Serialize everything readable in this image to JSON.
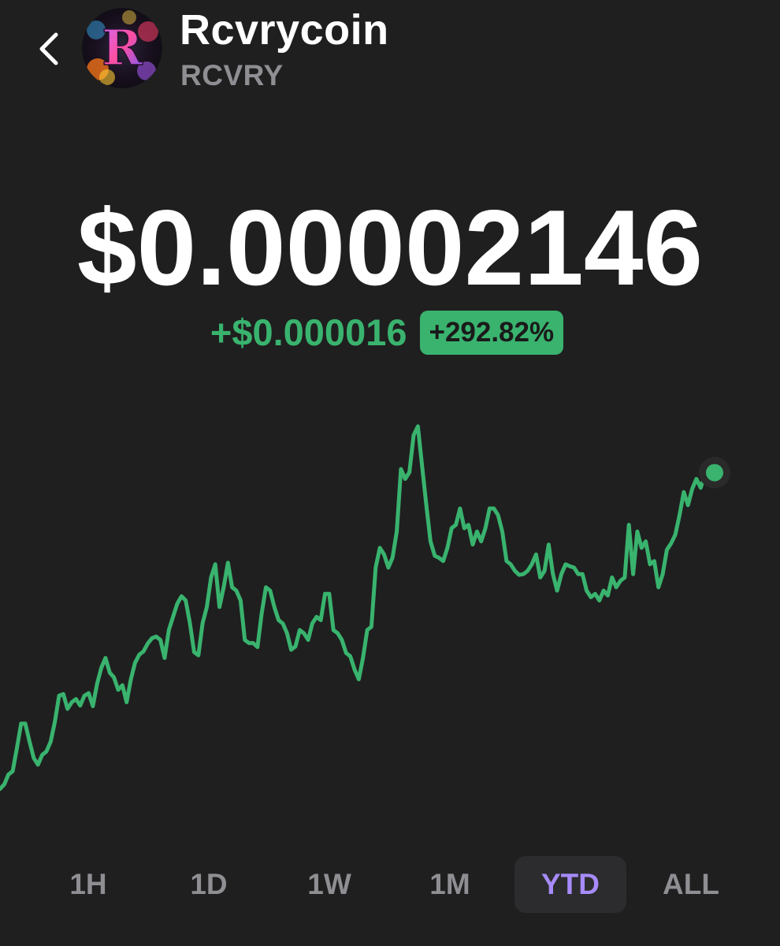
{
  "header": {
    "coin_name": "Rcvrycoin",
    "ticker": "RCVRY",
    "back_icon": "chevron-left-icon",
    "avatar_letter": "R"
  },
  "price": {
    "value": "$0.00002146",
    "change_abs": "+$0.000016",
    "change_pct": "+292.82%"
  },
  "colors": {
    "background": "#1f1f1f",
    "positive": "#39b36e",
    "active_range": "#a78bfa",
    "inactive_range": "#8e8e93"
  },
  "ranges": {
    "items": [
      "1H",
      "1D",
      "1W",
      "1M",
      "YTD",
      "ALL"
    ],
    "selected": "YTD"
  },
  "chart_data": {
    "type": "line",
    "series": [
      {
        "values": [
          5.46,
          5.6,
          5.9,
          6.0,
          6.7,
          7.45,
          7.45,
          6.9,
          6.4,
          6.2,
          6.5,
          6.6,
          6.9,
          7.5,
          8.3,
          8.35,
          7.9,
          8.1,
          8.2,
          8.0,
          8.3,
          8.38,
          7.98,
          8.66,
          9.15,
          9.45,
          9.0,
          8.86,
          8.48,
          8.62,
          8.1,
          8.8,
          9.3,
          9.55,
          9.65,
          9.89,
          10.05,
          10.1,
          10.0,
          9.45,
          10.3,
          10.7,
          11.1,
          11.33,
          11.2,
          10.5,
          9.63,
          9.53,
          10.5,
          11.0,
          11.9,
          12.3,
          11.0,
          11.6,
          12.35,
          11.6,
          11.5,
          11.2,
          10.0,
          9.9,
          9.9,
          9.78,
          10.8,
          11.6,
          11.5,
          11.0,
          10.6,
          10.5,
          10.2,
          9.7,
          9.8,
          10.3,
          10.2,
          10.0,
          10.5,
          10.7,
          10.6,
          11.4,
          11.4,
          10.3,
          10.2,
          10.0,
          9.6,
          9.5,
          9.1,
          8.8,
          9.45,
          10.3,
          10.4,
          12.2,
          12.8,
          12.6,
          12.2,
          12.5,
          13.3,
          15.2,
          14.9,
          15.1,
          16.23,
          16.5,
          15.3,
          14.1,
          13.0,
          12.56,
          12.5,
          12.4,
          12.8,
          13.4,
          13.5,
          14.0,
          13.4,
          13.5,
          12.9,
          13.3,
          13.0,
          13.4,
          14.0,
          14.0,
          13.8,
          13.3,
          12.4,
          12.3,
          12.1,
          11.98,
          12.0,
          12.1,
          12.3,
          12.6,
          11.9,
          12.1,
          12.9,
          12.0,
          11.5,
          12.0,
          12.3,
          12.24,
          12.2,
          12.0,
          12.0,
          11.5,
          11.3,
          11.4,
          11.2,
          11.5,
          11.35,
          11.9,
          11.6,
          11.8,
          11.9,
          13.5,
          12.0,
          13.3,
          12.8,
          13.0,
          12.3,
          12.4,
          11.6,
          12.0,
          12.74,
          12.94,
          13.2,
          13.8,
          14.5,
          14.1,
          14.6,
          14.9,
          14.63,
          15.0,
          15.09
        ]
      }
    ],
    "last_point_marker": true,
    "grid": false,
    "ylim": [
      5,
      17
    ]
  }
}
